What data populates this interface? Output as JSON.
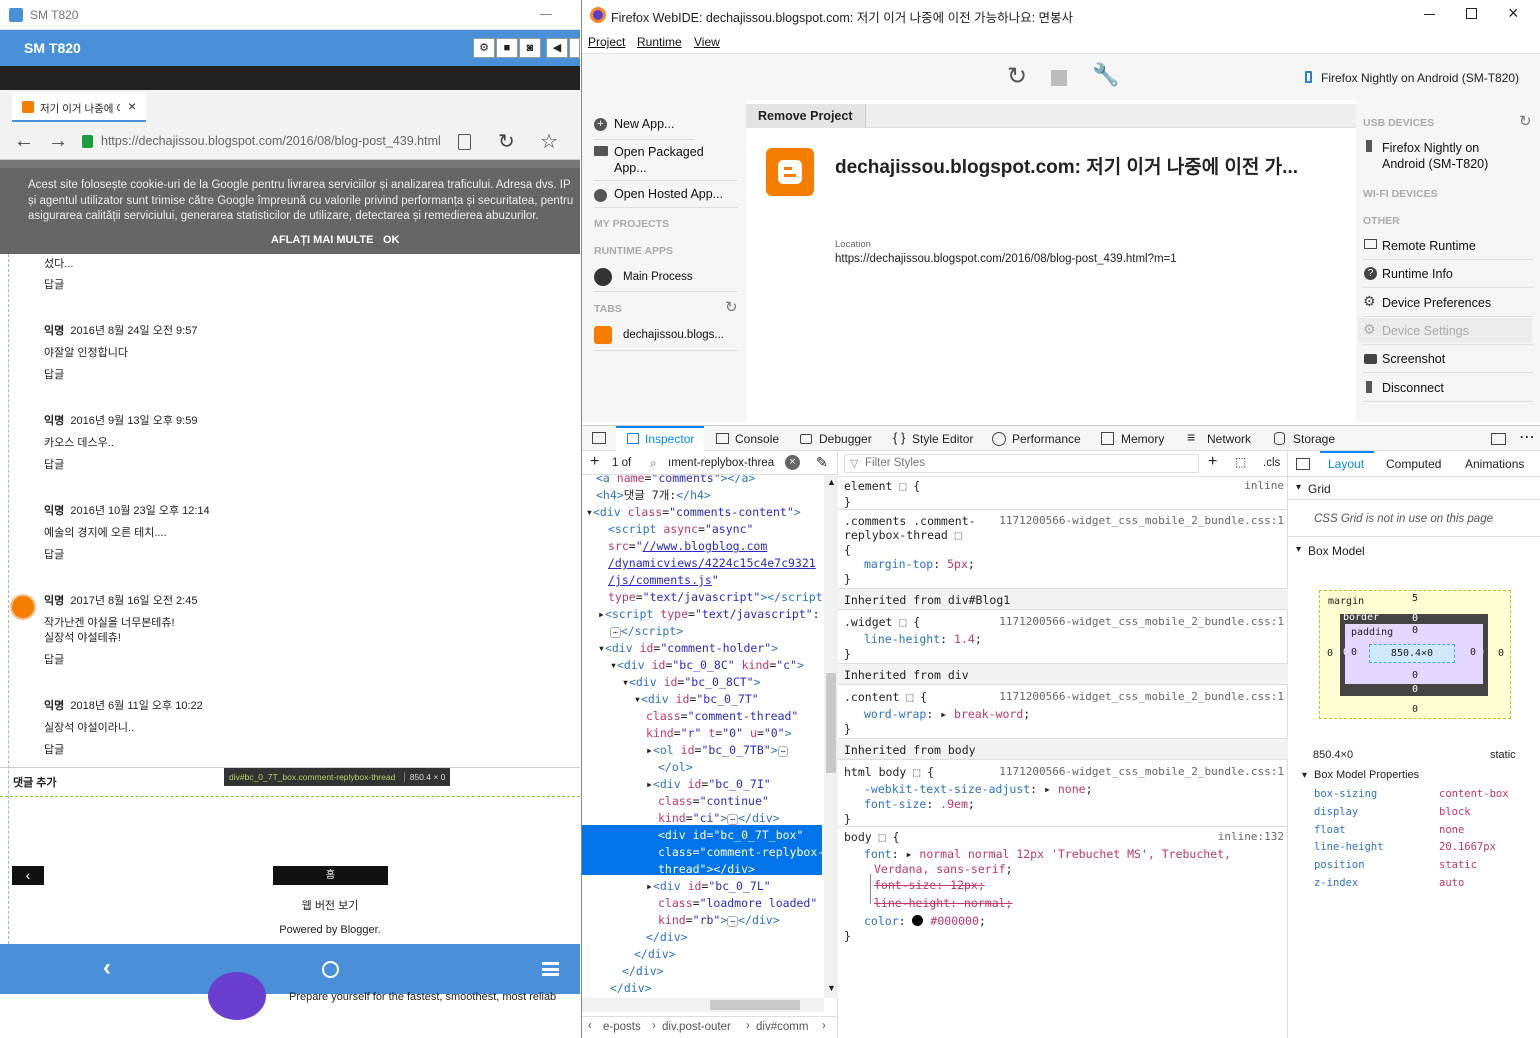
{
  "left": {
    "window_title": "SM T820",
    "device_bar_title": "SM T820",
    "browser_tab_title": "저기 이거 나중에 이",
    "url": "https://dechajissou.blogspot.com/2016/08/blog-post_439.html",
    "cookie": {
      "text": "Acest site folosește cookie-uri de la Google pentru livrarea serviciilor și analizarea traficului. Adresa dvs. IP și agentul utilizator sunt trimise către Google împreună cu valorile privind performanța și securitatea, pentru asigurarea calității serviciului, generarea statisticilor de utilizare, detectarea și remedierea abuzurilor.",
      "learn_more": "AFLAȚI MAI MULTE",
      "ok": "OK"
    },
    "comments": [
      {
        "text": "섰다...",
        "reply": "답글"
      },
      {
        "author": "익명",
        "date": "2016년 8월 24일 오전 9:57",
        "text": "야잘알 인정합니다",
        "reply": "답글"
      },
      {
        "author": "익명",
        "date": "2016년 9월 13일 오후 9:59",
        "text": "카오스 데스우..",
        "reply": "답글"
      },
      {
        "author": "익명",
        "date": "2016년 10월 23일 오후 12:14",
        "text": "예술의 경지에 오른 테치....",
        "reply": "답글"
      },
      {
        "author": "익명",
        "date": "2017년 8월 16일 오전 2:45",
        "text": "작가난겐 야실을 너무본테츄!",
        "text2": "실장석 야설테츄!",
        "reply": "답글"
      },
      {
        "author": "익명",
        "date": "2018년 6월 11일 오후 10:22",
        "text": "실장석 야설이라니..",
        "reply": "답글"
      }
    ],
    "add_comment": "댓글 추가",
    "highlight_label": "div#bc_0_7T_box.comment-replybox-thread",
    "highlight_size": "850.4 × 0",
    "prev": "‹",
    "home": "홈",
    "web_version": "웹 버전 보기",
    "powered": "Powered by Blogger.",
    "behind_text": "Prepare yourself for the fastest, smoothest, most reliab"
  },
  "right": {
    "window_title": "Firefox WebIDE: dechajissou.blogspot.com: 저기 이거 나중에 이전 가능하나요: 면봉사",
    "menu": [
      "Project",
      "Runtime",
      "View"
    ],
    "runtime_label": "Firefox Nightly on Android (SM-T820)",
    "left_panel": {
      "new_app": "New App...",
      "open_packaged": "Open Packaged App...",
      "open_hosted": "Open Hosted App...",
      "my_projects": "MY PROJECTS",
      "runtime_apps": "RUNTIME APPS",
      "main_process": "Main Process",
      "tabs": "TABS",
      "tab_item": "dechajissou.blogs..."
    },
    "main": {
      "remove_project": "Remove Project",
      "project_title": "dechajissou.blogspot.com: 저기 이거 나중에 이전 가...",
      "location_label": "Location",
      "location": "https://dechajissou.blogspot.com/2016/08/blog-post_439.html?m=1"
    },
    "right_panel": {
      "usb": "USB DEVICES",
      "device": "Firefox Nightly on Android (SM-T820)",
      "wifi": "WI-FI DEVICES",
      "other": "OTHER",
      "remote_runtime": "Remote Runtime",
      "runtime_info": "Runtime Info",
      "device_prefs": "Device Preferences",
      "device_settings": "Device Settings",
      "screenshot": "Screenshot",
      "disconnect": "Disconnect"
    },
    "devtools": {
      "tabs": [
        "Inspector",
        "Console",
        "Debugger",
        "Style Editor",
        "Performance",
        "Memory",
        "Network",
        "Storage"
      ],
      "search_count": "1 of",
      "search_value": "ıment-replybox-threa",
      "filter_placeholder": "Filter Styles",
      "cls": ".cls",
      "layout_tabs": [
        "Layout",
        "Computed",
        "Animations"
      ],
      "grid": "Grid",
      "grid_note": "CSS Grid is not in use on this page",
      "box_model": "Box Model",
      "box_model_props": "Box Model Properties",
      "box": {
        "margin": "margin",
        "border": "border",
        "padding": "padding",
        "content": "850.4×0",
        "mt": "5",
        "zero": "0"
      },
      "size": "850.4×0",
      "position": "static",
      "props": [
        {
          "k": "box-sizing",
          "v": "content-box"
        },
        {
          "k": "display",
          "v": "block"
        },
        {
          "k": "float",
          "v": "none"
        },
        {
          "k": "line-height",
          "v": "20.1667px"
        },
        {
          "k": "position",
          "v": "static"
        },
        {
          "k": "z-index",
          "v": "auto"
        }
      ],
      "breadcrumbs": [
        "e-posts",
        "div.post-outer",
        "div#comm"
      ],
      "rules": {
        "element": "element",
        "inline": "inline",
        "r1_sel": ".comments .comment-replybox-thread",
        "r1_src": "1171200566-widget_css_mobile_2_bundle.css:1",
        "r1_prop": "margin-top",
        "r1_val": "5px",
        "inh1": "Inherited from div#Blog1",
        "r2_sel": ".widget",
        "r2_prop": "line-height",
        "r2_val": "1.4",
        "inh2": "Inherited from div",
        "r3_sel": ".content",
        "r3_prop": "word-wrap",
        "r3_val": "break-word",
        "inh3": "Inherited from body",
        "r4_sel": "html body",
        "r4_p1": "-webkit-text-size-adjust",
        "r4_v1": "none",
        "r4_p2": "font-size",
        "r4_v2": ".9em",
        "r5_sel": "body",
        "r5_src": "inline:132",
        "r5_p1": "font",
        "r5_v1": "normal normal 12px 'Trebuchet MS', Trebuchet,",
        "r5_v1b": "Verdana, sans-serif",
        "r5_s1": "font-size: 12px;",
        "r5_s2": "line-height: normal;",
        "r5_p2": "color",
        "r5_v2": "#000000"
      }
    }
  },
  "colors": {
    "accent": "#4a90d9",
    "blogger": "#f57d00",
    "selection": "#0074e8"
  }
}
